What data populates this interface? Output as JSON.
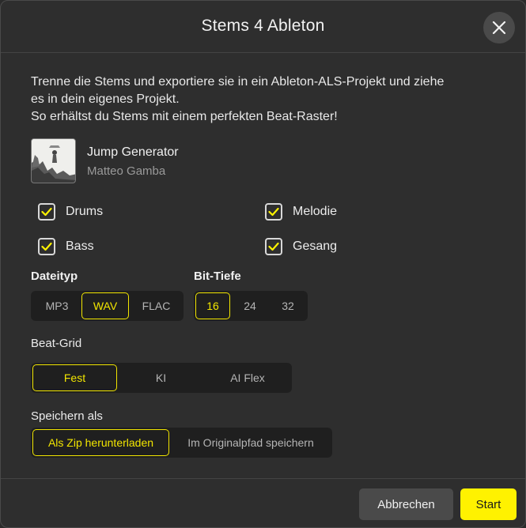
{
  "dialog": {
    "title": "Stems 4 Ableton",
    "intro": [
      "Trenne die Stems und exportiere sie in ein Ableton-ALS-Projekt und ziehe",
      "es in dein eigenes Projekt.",
      "So erhältst du Stems mit einem perfekten Beat-Raster!"
    ]
  },
  "track": {
    "title": "Jump Generator",
    "artist": "Matteo Gamba"
  },
  "stems": [
    {
      "label": "Drums",
      "checked": true
    },
    {
      "label": "Melodie",
      "checked": true
    },
    {
      "label": "Bass",
      "checked": true
    },
    {
      "label": "Gesang",
      "checked": true
    }
  ],
  "filetype": {
    "label": "Dateityp",
    "options": [
      "MP3",
      "WAV",
      "FLAC"
    ],
    "selected": "WAV"
  },
  "bitdepth": {
    "label": "Bit-Tiefe",
    "options": [
      "16",
      "24",
      "32"
    ],
    "selected": "16"
  },
  "beatgrid": {
    "label": "Beat-Grid",
    "options": [
      "Fest",
      "KI",
      "AI Flex"
    ],
    "selected": "Fest"
  },
  "saveas": {
    "label": "Speichern als",
    "options": [
      "Als Zip herunterladen",
      "Im Originalpfad speichern"
    ],
    "selected": "Als Zip herunterladen"
  },
  "footer": {
    "cancel_label": "Abbrechen",
    "start_label": "Start"
  },
  "colors": {
    "accent": "#fff200",
    "background": "#2e2e2e",
    "segment_bg": "#1f1f1f"
  },
  "icons": {
    "close": "close-icon",
    "check": "checkmark-icon"
  }
}
